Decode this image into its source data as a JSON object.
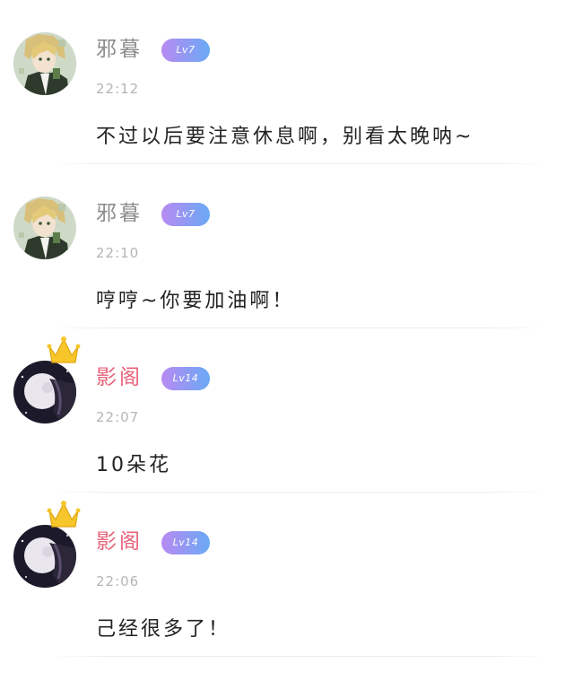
{
  "theme": {
    "name_color_regular": "#8c8c8c",
    "name_color_vip": "#e8637a",
    "timestamp_color": "#b5b5b5",
    "badge_gradient": [
      "#b88af2",
      "#6aa9f4"
    ]
  },
  "comments": [
    {
      "username": "邪暮",
      "level": "Lv7",
      "time": "22:12",
      "text": "不过以后要注意休息啊，别看太晚呐~",
      "avatar": "anime-boy-avatar",
      "vip": false
    },
    {
      "username": "邪暮",
      "level": "Lv7",
      "time": "22:10",
      "text": "哼哼~你要加油啊！",
      "avatar": "anime-boy-avatar",
      "vip": false
    },
    {
      "username": "影阁",
      "level": "Lv14",
      "time": "22:07",
      "text": "10朵花",
      "avatar": "moon-avatar",
      "vip": true
    },
    {
      "username": "影阁",
      "level": "Lv14",
      "time": "22:06",
      "text": "己经很多了！",
      "avatar": "moon-avatar",
      "vip": true
    }
  ]
}
